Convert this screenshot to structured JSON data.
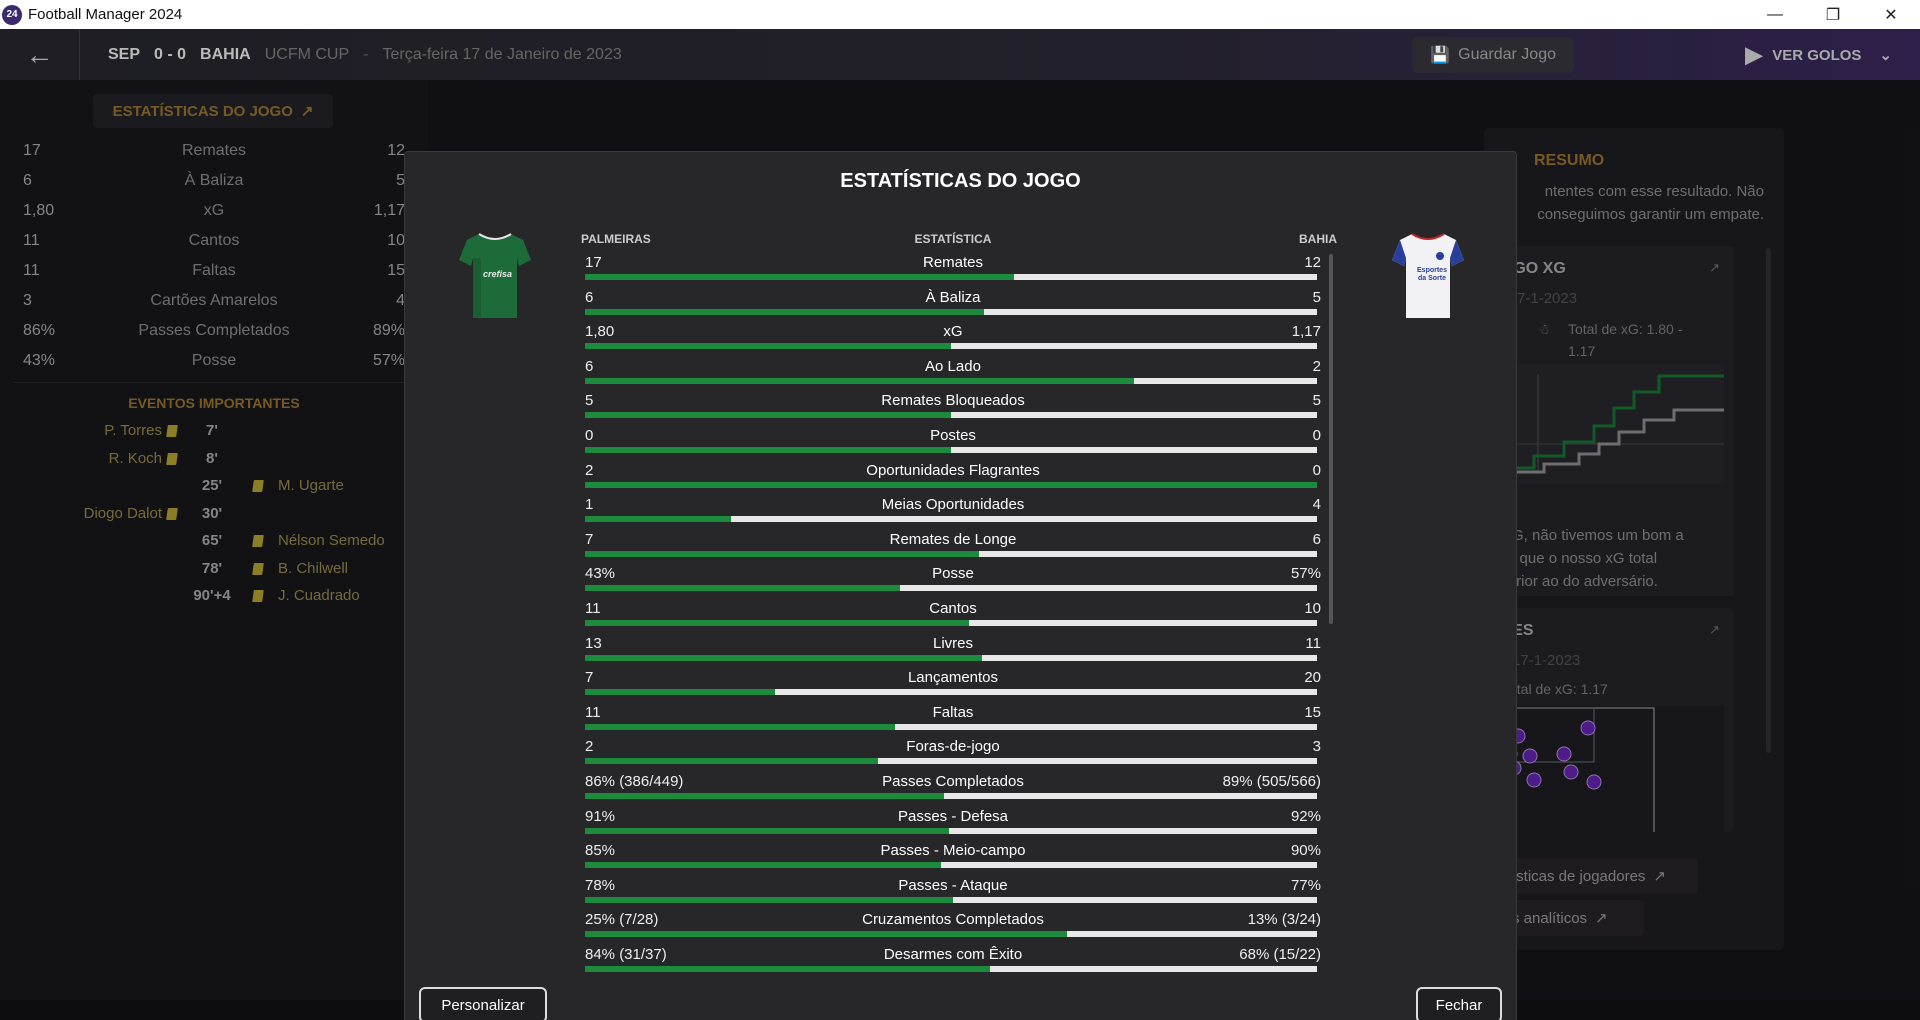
{
  "window": {
    "app_title": "Football Manager 2024",
    "app_logo": "24"
  },
  "header": {
    "home_abbr": "SEP",
    "score": "0 - 0",
    "away_abbr": "BAHIA",
    "competition": "UCFM CUP",
    "separator": "-",
    "date": "Terça-feira 17 de Janeiro de 2023",
    "save_label": "Guardar Jogo",
    "goals_label": "VER GOLOS"
  },
  "left_stats": {
    "title": "ESTATÍSTICAS DO JOGO",
    "rows": [
      {
        "home": "17",
        "label": "Remates",
        "away": "12"
      },
      {
        "home": "6",
        "label": "À Baliza",
        "away": "5"
      },
      {
        "home": "1,80",
        "label": "xG",
        "away": "1,17"
      },
      {
        "home": "11",
        "label": "Cantos",
        "away": "10"
      },
      {
        "home": "11",
        "label": "Faltas",
        "away": "15"
      },
      {
        "home": "3",
        "label": "Cartões Amarelos",
        "away": "4"
      },
      {
        "home": "86%",
        "label": "Passes Completados",
        "away": "89%"
      },
      {
        "home": "43%",
        "label": "Posse",
        "away": "57%"
      }
    ]
  },
  "events": {
    "title": "EVENTOS IMPORTANTES",
    "rows": [
      {
        "home": "P. Torres",
        "minute": "7'",
        "away": ""
      },
      {
        "home": "R. Koch",
        "minute": "8'",
        "away": ""
      },
      {
        "home": "",
        "minute": "25'",
        "away": "M. Ugarte"
      },
      {
        "home": "Diogo Dalot",
        "minute": "30'",
        "away": ""
      },
      {
        "home": "",
        "minute": "65'",
        "away": "Nélson Semedo"
      },
      {
        "home": "",
        "minute": "78'",
        "away": "B. Chilwell"
      },
      {
        "home": "",
        "minute": "90'+4",
        "away": "J. Cuadrado"
      }
    ]
  },
  "right_panel": {
    "resumo_title": "RESUMO",
    "resumo_text": "ntentes com esse resultado. Não conseguimos garantir um empate.",
    "xg_card_title": "JOGO XG",
    "xg_card_date": "a, 17-1-2023",
    "xg_card_total": "Total de xG: 1.80 - 1.17",
    "xg_card_text": "o xG, não tivemos um bom a vez que o nosso xG total inferior ao do adversário.",
    "shots_card_title": "ATES",
    "shots_card_date": "ia, 17-1-2023",
    "shots_card_total": "Total de xG: 1.17",
    "link_players": "ísticas de jogadores",
    "link_analytics": "s analíticos"
  },
  "modal": {
    "title": "ESTATÍSTICAS DO JOGO",
    "home_team": "PALMEIRAS",
    "stat_header": "ESTATÍSTICA",
    "away_team": "BAHIA",
    "home_kit_text": "crefisa",
    "away_kit_text": "Esportes da Sorte",
    "customize_label": "Personalizar",
    "close_label": "Fechar",
    "colors": {
      "home_bar": "#1d8b3e",
      "away_bar": "#e8e8e8"
    },
    "stats": [
      {
        "home": "17",
        "label": "Remates",
        "away": "12",
        "home_share": 0.586
      },
      {
        "home": "6",
        "label": "À Baliza",
        "away": "5",
        "home_share": 0.545
      },
      {
        "home": "1,80",
        "label": "xG",
        "away": "1,17",
        "home_share": 0.5
      },
      {
        "home": "6",
        "label": "Ao Lado",
        "away": "2",
        "home_share": 0.75
      },
      {
        "home": "5",
        "label": "Remates Bloqueados",
        "away": "5",
        "home_share": 0.5
      },
      {
        "home": "0",
        "label": "Postes",
        "away": "0",
        "home_share": 0.5
      },
      {
        "home": "2",
        "label": "Oportunidades Flagrantes",
        "away": "0",
        "home_share": 1.0
      },
      {
        "home": "1",
        "label": "Meias Oportunidades",
        "away": "4",
        "home_share": 0.2
      },
      {
        "home": "7",
        "label": "Remates de Longe",
        "away": "6",
        "home_share": 0.538
      },
      {
        "home": "43%",
        "label": "Posse",
        "away": "57%",
        "home_share": 0.43
      },
      {
        "home": "11",
        "label": "Cantos",
        "away": "10",
        "home_share": 0.524
      },
      {
        "home": "13",
        "label": "Livres",
        "away": "11",
        "home_share": 0.542
      },
      {
        "home": "7",
        "label": "Lançamentos",
        "away": "20",
        "home_share": 0.259
      },
      {
        "home": "11",
        "label": "Faltas",
        "away": "15",
        "home_share": 0.423
      },
      {
        "home": "2",
        "label": "Foras-de-jogo",
        "away": "3",
        "home_share": 0.4
      },
      {
        "home": "86% (386/449)",
        "label": "Passes Completados",
        "away": "89% (505/566)",
        "home_share": 0.49
      },
      {
        "home": "91%",
        "label": "Passes - Defesa",
        "away": "92%",
        "home_share": 0.497
      },
      {
        "home": "85%",
        "label": "Passes - Meio-campo",
        "away": "90%",
        "home_share": 0.486
      },
      {
        "home": "78%",
        "label": "Passes - Ataque",
        "away": "77%",
        "home_share": 0.503
      },
      {
        "home": "25% (7/28)",
        "label": "Cruzamentos Completados",
        "away": "13% (3/24)",
        "home_share": 0.658
      },
      {
        "home": "84% (31/37)",
        "label": "Desarmes com Êxito",
        "away": "68% (15/22)",
        "home_share": 0.553
      }
    ]
  }
}
